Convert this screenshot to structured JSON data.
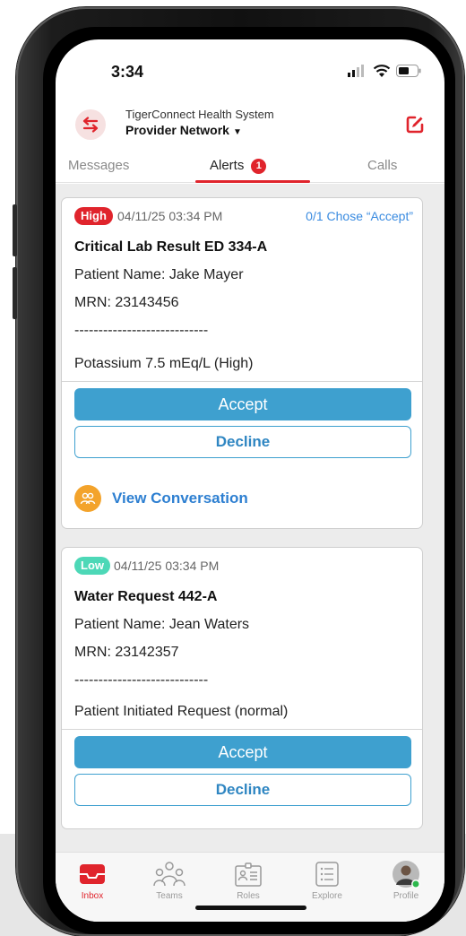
{
  "status_bar": {
    "time": "3:34"
  },
  "header": {
    "org_name": "TigerConnect Health System",
    "network_name": "Provider Network"
  },
  "tabs": [
    {
      "label": "Messages"
    },
    {
      "label": "Alerts",
      "badge": "1"
    },
    {
      "label": "Calls"
    }
  ],
  "alerts": [
    {
      "priority": "High",
      "priority_color": "#e0242c",
      "timestamp": "04/11/25 03:34 PM",
      "response_summary": "0/1 Chose “Accept”",
      "title": "Critical Lab Result ED 334-A",
      "patient": "Patient Name: Jake Mayer",
      "mrn": "MRN: 23143456",
      "separator": "----------------------------",
      "detail": "Potassium 7.5 mEq/L (High)",
      "accept_label": "Accept",
      "decline_label": "Decline",
      "conversation_label": "View Conversation"
    },
    {
      "priority": "Low",
      "priority_color": "#4dd8b7",
      "timestamp": "04/11/25 03:34 PM",
      "title": "Water Request 442-A",
      "patient": "Patient Name: Jean Waters",
      "mrn": "MRN: 23142357",
      "separator": "----------------------------",
      "detail": "Patient Initiated Request (normal)",
      "accept_label": "Accept",
      "decline_label": "Decline"
    }
  ],
  "bottom_nav": [
    {
      "label": "Inbox",
      "icon": "inbox-icon",
      "active": true
    },
    {
      "label": "Teams",
      "icon": "teams-icon"
    },
    {
      "label": "Roles",
      "icon": "roles-icon"
    },
    {
      "label": "Explore",
      "icon": "explore-icon"
    },
    {
      "label": "Profile",
      "icon": "avatar"
    }
  ],
  "colors": {
    "brand_red": "#e0242c",
    "accept_blue": "#3ea0cf",
    "link_blue": "#2d7fd1",
    "conversation_orange": "#f3a32b"
  }
}
